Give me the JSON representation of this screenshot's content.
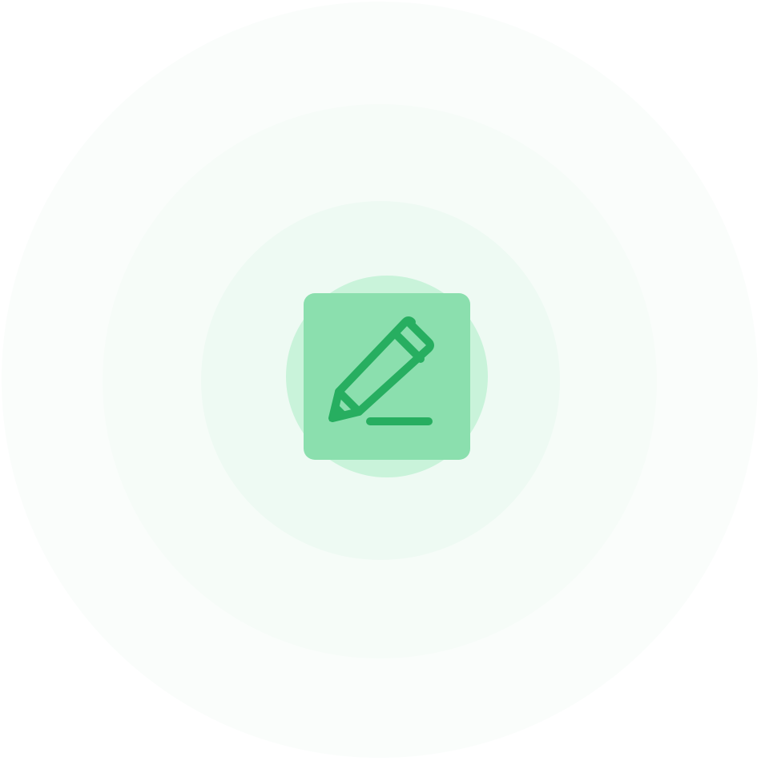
{
  "illustration": {
    "icon": "pencil-edit-icon",
    "colors": {
      "page_background": "#ffffff",
      "ring_outer": "#fafdfb",
      "ring_middle": "#f6fcf8",
      "ring_inner": "#eefaf3",
      "ring_core": "#c9f3da",
      "tile_background": "#8bdfae",
      "icon_stroke": "#27ae60"
    }
  }
}
